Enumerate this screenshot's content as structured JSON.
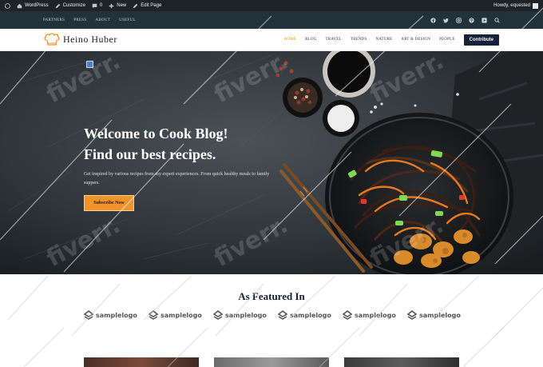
{
  "admin_bar": {
    "items": [
      {
        "label": "",
        "icon": "wordpress-icon"
      },
      {
        "label": "WordPress",
        "icon": "home-icon"
      },
      {
        "label": "Customize",
        "icon": "pencil-icon"
      },
      {
        "label": "0",
        "icon": "comment-icon"
      },
      {
        "label": "New",
        "icon": "plus-icon"
      },
      {
        "label": "Edit Page",
        "icon": "pencil-icon"
      }
    ],
    "greeting": "Howdy, equested"
  },
  "top_nav": {
    "items": [
      "PARTNERS",
      "PRESS",
      "ABOUT",
      "USEFUL"
    ]
  },
  "social_icons": [
    "facebook-icon",
    "twitter-icon",
    "instagram-icon",
    "pinterest-icon",
    "youtube-icon",
    "search-icon"
  ],
  "header": {
    "logo_text": "Heino Huber",
    "nav": [
      "HOME",
      "BLOG",
      "TRAVEL",
      "TRENDS",
      "NATURE",
      "ART & DESIGN",
      "PEOPLE"
    ],
    "active_nav": "HOME",
    "contribute_label": "Contribute"
  },
  "hero": {
    "title_line1": "Welcome to Cook Blog!",
    "title_line2": "Find our best recipes.",
    "description": "Get inspired by various recipes from my expert experiences. From quick healthy meals to family suppers.",
    "cta_label": "Subscribe Now"
  },
  "featured": {
    "heading": "As Featured In",
    "logos": [
      "samplelogo",
      "samplelogo",
      "samplelogo",
      "samplelogo",
      "samplelogo",
      "samplelogo"
    ]
  },
  "watermark": "fiverr.",
  "colors": {
    "accent": "#f0932b",
    "navy": "#13213a",
    "admin_bar": "#1d2327",
    "top_strip": "#22313a"
  }
}
